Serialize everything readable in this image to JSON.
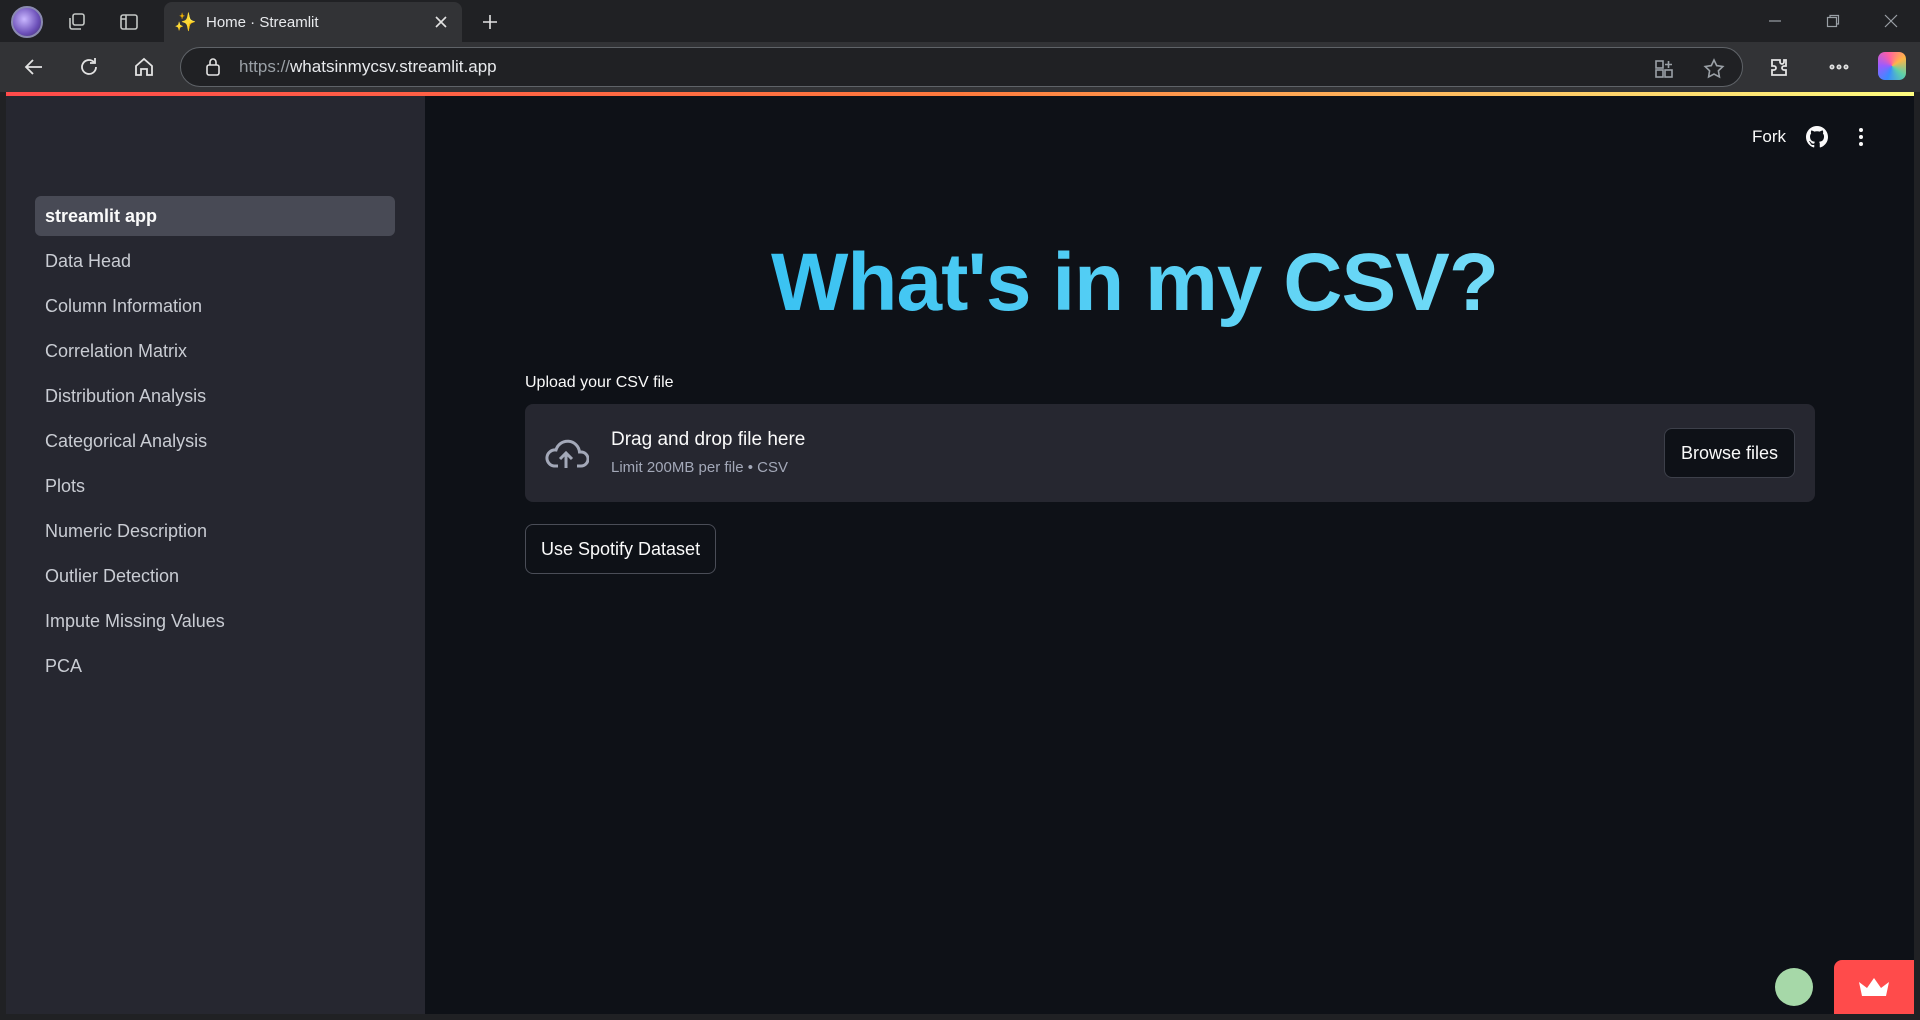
{
  "browser": {
    "tab_title": "Home · Streamlit",
    "tab_favicon": "✨",
    "url_host": "whatsinmycsv.streamlit.app",
    "url_scheme": "https://"
  },
  "app": {
    "sidebar": {
      "items": [
        {
          "label": "streamlit app",
          "active": true
        },
        {
          "label": "Data Head"
        },
        {
          "label": "Column Information"
        },
        {
          "label": "Correlation Matrix"
        },
        {
          "label": "Distribution Analysis"
        },
        {
          "label": "Categorical Analysis"
        },
        {
          "label": "Plots"
        },
        {
          "label": "Numeric Description"
        },
        {
          "label": "Outlier Detection"
        },
        {
          "label": "Impute Missing Values"
        },
        {
          "label": "PCA"
        }
      ]
    },
    "header": {
      "fork_label": "Fork"
    },
    "title": "What's in my CSV?",
    "uploader": {
      "label": "Upload your CSV file",
      "drop_text": "Drag and drop file here",
      "limit_text": "Limit 200MB per file • CSV",
      "browse_label": "Browse files"
    },
    "spotify_button": "Use Spotify Dataset"
  },
  "colors": {
    "accent": "#ff4b4b",
    "title_gradient_start": "#1fb6f0",
    "title_gradient_end": "#8ee6fb",
    "sidebar_bg": "#262730",
    "main_bg": "#0e1117"
  }
}
